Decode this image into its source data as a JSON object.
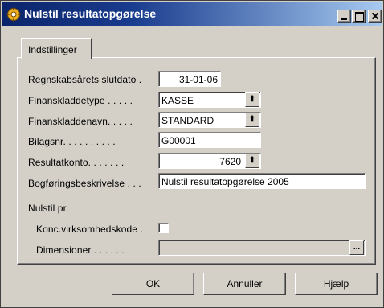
{
  "window": {
    "title": "Nulstil resultatopgørelse",
    "controls": {
      "minimize": "_",
      "maximize": "□",
      "close": "X"
    }
  },
  "tabs": [
    {
      "label": "Indstillinger",
      "selected": true
    }
  ],
  "form": {
    "regnskab_label": "Regnskabsårets slutdato  .",
    "regnskab_value": "31-01-06",
    "finanstype_label": "Finanskladdetype . . . . .",
    "finanstype_value": "KASSE",
    "finansnavn_label": "Finanskladdenavn. . . . .",
    "finansnavn_value": "STANDARD",
    "bilag_label": "Bilagsnr. . . . . . . . . .",
    "bilag_value": "G00001",
    "resultat_label": "Resultatkonto. . . . . . .",
    "resultat_value": "7620",
    "bogforing_label": "Bogføringsbeskrivelse . . .",
    "bogforing_value": "Nulstil resultatopgørelse 2005",
    "nulstil_label": "Nulstil pr.",
    "konc_label": "Konc.virksomhedskode  .",
    "konc_checked": false,
    "dimensioner_label": "Dimensioner  . . . . . .",
    "dimensioner_value": "",
    "assist_button": "...",
    "lookup_glyph": "🠅"
  },
  "buttons": {
    "ok": "OK",
    "cancel": "Annuller",
    "help": "Hjælp"
  },
  "icons": {
    "title_icon": "navision-gear-icon",
    "lookup_icon": "arrow-up-icon"
  }
}
